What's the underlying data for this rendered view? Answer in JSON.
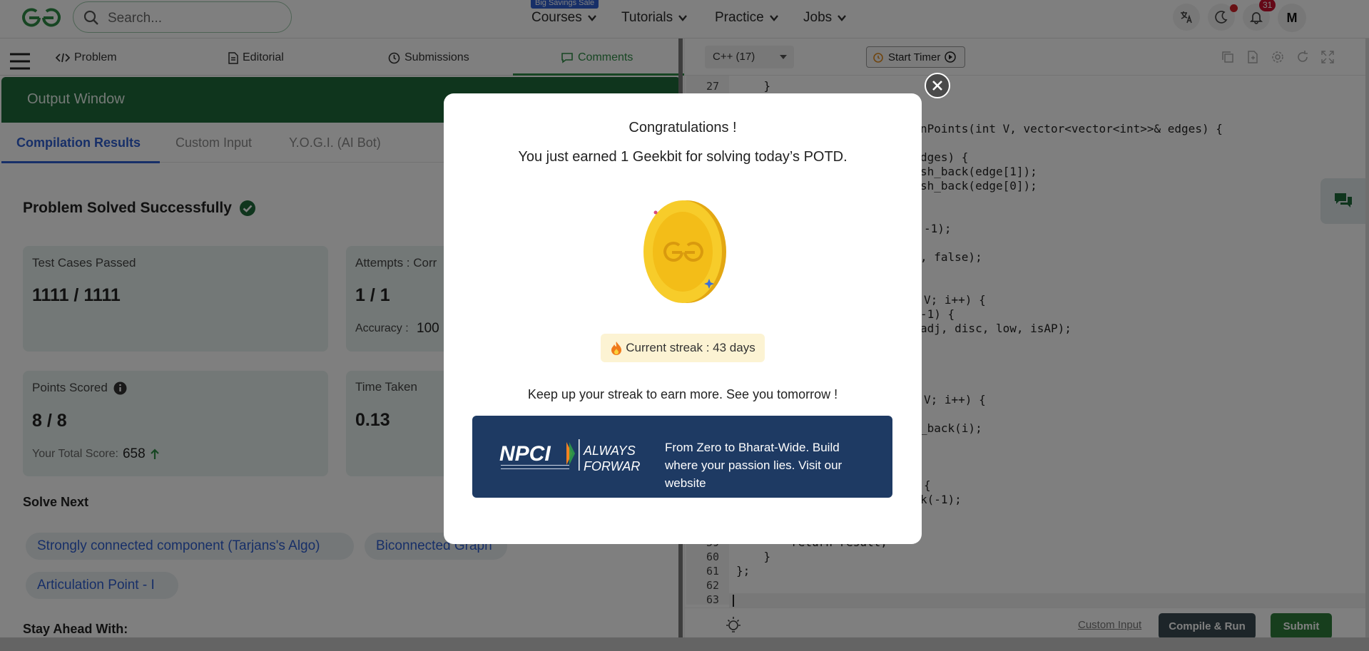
{
  "topnav": {
    "search_placeholder": "Search...",
    "sale_badge": "Big Savings Sale",
    "menu": [
      "Courses",
      "Tutorials",
      "Practice",
      "Jobs"
    ],
    "notification_count": "31",
    "avatar_initial": "M"
  },
  "problem_tabs": [
    "Problem",
    "Editorial",
    "Submissions",
    "Comments"
  ],
  "output": {
    "title": "Output Window",
    "tabs": [
      "Compilation Results",
      "Custom Input",
      "Y.O.G.I. (AI Bot)"
    ],
    "solved_text": "Problem Solved Successfully",
    "cards": {
      "tests_label": "Test Cases Passed",
      "tests_value": "1111 / 1111",
      "attempts_label": "Attempts : Corr",
      "attempts_value": "1 / 1",
      "accuracy_label": "Accuracy :",
      "accuracy_value": "100",
      "points_label": "Points Scored",
      "points_value": "8 / 8",
      "total_label": "Your Total Score:",
      "total_value": "658",
      "time_label": "Time Taken",
      "time_value": "0.13"
    },
    "solve_next_title": "Solve Next",
    "solve_next": [
      "Strongly connected component (Tarjans's Algo)",
      "Biconnected Graph",
      "Articulation Point - I"
    ],
    "stay_ahead": "Stay Ahead With:"
  },
  "editor": {
    "language": "C++ (17)",
    "timer_label": "Start Timer",
    "custom_input": "Custom Input",
    "compile_run": "Compile & Run",
    "submit": "Submit",
    "lines": [
      {
        "n": "27",
        "text": "    }"
      },
      {
        "n": "",
        "text": "nPoints(int V, vector<vector<int>>& edges) {"
      },
      {
        "n": "",
        "text": "dges) {"
      },
      {
        "n": "",
        "text": "sh_back(edge[1]);"
      },
      {
        "n": "",
        "text": "sh_back(edge[0]);"
      },
      {
        "n": "",
        "text": "-1);"
      },
      {
        "n": "",
        "text": ", false);"
      },
      {
        "n": "",
        "text": "V; i++) {"
      },
      {
        "n": "",
        "text": "-1) {"
      },
      {
        "n": "",
        "text": "adj, disc, low, isAP);"
      },
      {
        "n": "",
        "text": "V; i++) {"
      },
      {
        "n": "",
        "text": "_back(i);"
      },
      {
        "n": "",
        "text": "{"
      },
      {
        "n": "",
        "text": "k(-1);"
      },
      {
        "n": "59",
        "text": "        return result;"
      },
      {
        "n": "60",
        "text": "    }"
      },
      {
        "n": "61",
        "text": "};"
      },
      {
        "n": "62",
        "text": ""
      },
      {
        "n": "63",
        "text": ""
      }
    ]
  },
  "modal": {
    "title": "Congratulations !",
    "subtitle": "You just earned 1 Geekbit for solving today’s POTD.",
    "streak": "Current streak : 43 days",
    "keep_up": "Keep up your streak to earn more. See you tomorrow !",
    "banner_text": "From Zero to Bharat-Wide. Build where your passion lies. Visit our website"
  },
  "colors": {
    "brand_green": "#2f8d46",
    "output_header": "#1e6a3a",
    "link_blue": "#2f5fd1",
    "banner_navy": "#1e3a63"
  }
}
